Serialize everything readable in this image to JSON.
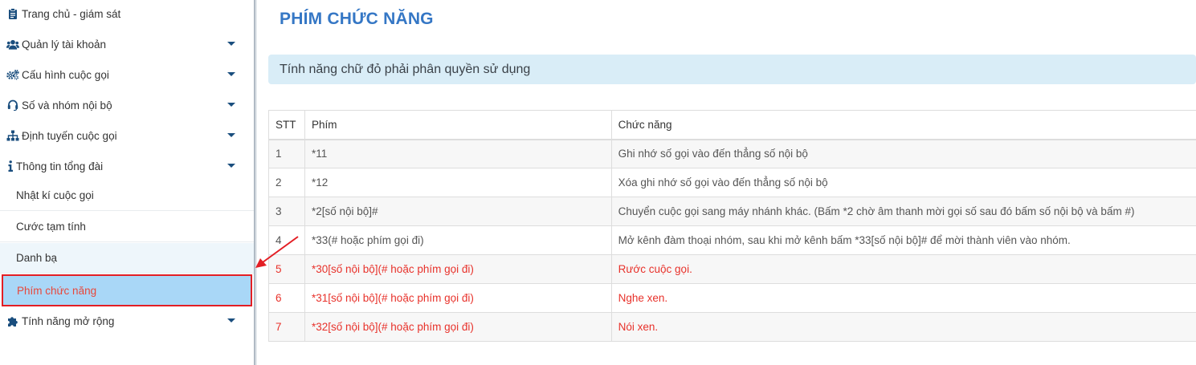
{
  "sidebar": {
    "top_items": [
      {
        "label": "Trang chủ - giám sát",
        "icon": "clipboard-icon",
        "has_caret": false
      },
      {
        "label": "Quản lý tài khoản",
        "icon": "users-icon",
        "has_caret": true
      },
      {
        "label": "Cấu hình cuộc gọi",
        "icon": "gears-icon",
        "has_caret": true
      },
      {
        "label": "Số và nhóm nội bộ",
        "icon": "headset-icon",
        "has_caret": true
      },
      {
        "label": "Định tuyến cuộc gọi",
        "icon": "sitemap-icon",
        "has_caret": true
      },
      {
        "label": "Thông tin tổng đài",
        "icon": "info-icon",
        "has_caret": true
      }
    ],
    "sub_items": [
      {
        "label": "Nhật kí cuộc gọi"
      },
      {
        "label": "Cước tạm tính"
      },
      {
        "label": "Danh bạ"
      },
      {
        "label": "Phím chức năng"
      }
    ],
    "bottom_item": {
      "label": "Tính năng mở rộng",
      "icon": "puzzle-icon",
      "has_caret": true
    }
  },
  "main": {
    "title": "PHÍM CHỨC NĂNG",
    "notice": "Tính năng chữ đỏ phải phân quyền sử dụng"
  },
  "table": {
    "headers": [
      "STT",
      "Phím",
      "Chức năng"
    ],
    "rows": [
      {
        "stt": "1",
        "key": "*11",
        "function": "Ghi nhớ số gọi vào đến thẳng số nội bộ",
        "restricted": false
      },
      {
        "stt": "2",
        "key": "*12",
        "function": "Xóa ghi nhớ số gọi vào đến thẳng số nội bộ",
        "restricted": false
      },
      {
        "stt": "3",
        "key": "*2[số nội bộ]#",
        "function": "Chuyển cuộc gọi sang máy nhánh khác. (Bấm *2 chờ âm thanh mời gọi số sau đó bấm số nội bộ và bấm #)",
        "restricted": false
      },
      {
        "stt": "4",
        "key": "*33(# hoặc phím gọi đi)",
        "function": "Mở kênh đàm thoại nhóm, sau khi mở kênh bấm *33[số nội bộ]# để mời thành viên vào nhóm.",
        "restricted": false
      },
      {
        "stt": "5",
        "key": "*30[số nội bộ](# hoặc phím gọi đi)",
        "function": "Rước cuộc gọi.",
        "restricted": true
      },
      {
        "stt": "6",
        "key": "*31[số nội bộ](# hoặc phím gọi đi)",
        "function": "Nghe xen.",
        "restricted": true
      },
      {
        "stt": "7",
        "key": "*32[số nội bộ](# hoặc phím gọi đi)",
        "function": "Nói xen.",
        "restricted": true
      }
    ]
  },
  "colors": {
    "title_blue": "#3577c5",
    "notice_bg": "#d9edf7",
    "restricted_red": "#e8322b",
    "active_bg": "#a9d7f7",
    "annotation_red": "#e31e24"
  }
}
